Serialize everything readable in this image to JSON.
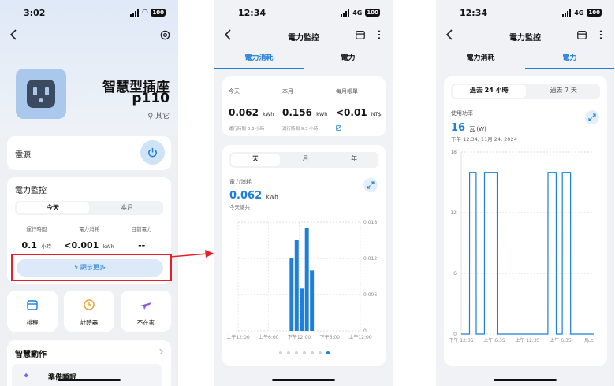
{
  "screen1": {
    "status": {
      "time": "3:02",
      "battery": "100"
    },
    "device": {
      "name": "智慧型插座",
      "model": "p110",
      "location": "其它"
    },
    "power": {
      "label": "電源"
    },
    "monitor": {
      "title": "電力監控",
      "tabs": [
        "今天",
        "本月"
      ],
      "stats": [
        {
          "label": "運行時間",
          "value": "0.1",
          "unit": "小時"
        },
        {
          "label": "電力消耗",
          "value": "<0.001",
          "unit": "kWh"
        },
        {
          "label": "目前電力",
          "value": "--",
          "unit": ""
        }
      ],
      "show_more": "顯示更多"
    },
    "shortcuts": [
      "排程",
      "計時器",
      "不在家"
    ],
    "smart": {
      "title": "智慧動作",
      "item": "準備睡眠"
    },
    "colors": {
      "accent": "#1e7ed8",
      "highlight": "#e5202a"
    }
  },
  "screen2": {
    "status": {
      "time": "12:34",
      "network": "4G",
      "battery": "100"
    },
    "title": "電力監控",
    "tabs": [
      "電力消耗",
      "電力"
    ],
    "summary": [
      {
        "label": "今天",
        "value": "0.062",
        "unit": "kWh",
        "foot": "運行時間 3.6 小時"
      },
      {
        "label": "本月",
        "value": "0.156",
        "unit": "kWh",
        "foot": "運行時間 9.3 小時"
      },
      {
        "label": "每月帳單",
        "value": "<0.01",
        "unit": "NT$",
        "foot": ""
      }
    ],
    "period_tabs": [
      "天",
      "月",
      "年"
    ],
    "metric": {
      "label": "電力消耗",
      "value": "0.062",
      "unit": "kWh",
      "sub": "今天總共"
    },
    "chart_data": {
      "type": "bar",
      "title": "",
      "ylabel": "",
      "ylim": [
        0,
        0.018
      ],
      "y_ticks": [
        "0.018",
        "0.012",
        "0.006",
        "0"
      ],
      "x_ticks": [
        "上午12:00",
        "上午6:00",
        "下午12:00",
        "下午6:00",
        "上午12:00"
      ],
      "hours": [
        10,
        11,
        12,
        13,
        14
      ],
      "values": [
        0.012,
        0.015,
        0.007,
        0.017,
        0.01
      ]
    },
    "page_dots": 7
  },
  "screen3": {
    "status": {
      "time": "12:34",
      "network": "4G",
      "battery": "100"
    },
    "title": "電力監控",
    "tabs": [
      "電力消耗",
      "電力"
    ],
    "range_tabs": [
      "過去 24 小時",
      "過去 7 天"
    ],
    "metric": {
      "label": "使用功率",
      "value": "16",
      "unit": "瓦 (W)",
      "date": "下午 12:34, 11月 24, 2024"
    },
    "chart_data": {
      "type": "line",
      "title": "",
      "ylabel": "",
      "ylim": [
        0,
        18
      ],
      "y_ticks": [
        "18",
        "12",
        "6",
        "0"
      ],
      "x_ticks": [
        "下午 12:35",
        "上午 6:35",
        "上午 12:35",
        "上午 6:35",
        "馬上"
      ],
      "x_range": [
        0,
        24
      ],
      "x": [
        0,
        1.5,
        1.51,
        2.7,
        2.71,
        4.2,
        4.21,
        6.5,
        6.51,
        8.0,
        8.01,
        15.7,
        15.71,
        17.2,
        17.21,
        18.3,
        18.31,
        19.8,
        19.81,
        24
      ],
      "y": [
        0,
        0,
        16,
        16,
        0,
        0,
        16,
        16,
        0,
        0,
        0,
        0,
        16,
        16,
        0,
        0,
        16,
        16,
        0,
        0
      ]
    }
  }
}
